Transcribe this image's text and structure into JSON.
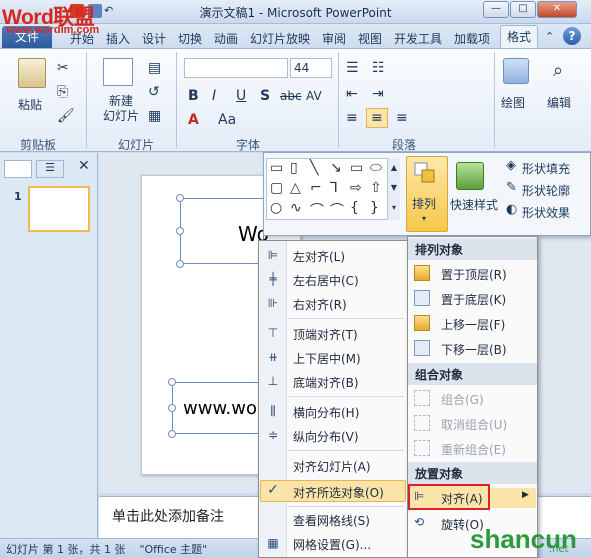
{
  "window": {
    "title": "演示文稿1 - Microsoft PowerPoint",
    "buttons": [
      "—",
      "□",
      "✕"
    ]
  },
  "watermark": {
    "logo": "Word联盟",
    "url": "www.wordlm.com",
    "site": "shancun",
    "site_sub": ".net"
  },
  "tabs": {
    "file": "文件",
    "items": [
      "开始",
      "插入",
      "设计",
      "切换",
      "动画",
      "幻灯片放映",
      "审阅",
      "视图",
      "开发工具",
      "加载项"
    ],
    "format": "格式",
    "help": "?"
  },
  "ribbon": {
    "clipboard": {
      "label": "剪贴板",
      "paste": "粘贴"
    },
    "slides": {
      "label": "幻灯片",
      "new_slide": "新建\n幻灯片"
    },
    "font": {
      "label": "字体",
      "font_name": "",
      "font_size": "44",
      "bold": "B",
      "italic": "I",
      "underline": "U",
      "shadow": "S",
      "strike": "abc",
      "spacing": "AV",
      "color": "A",
      "case": "Aa"
    },
    "paragraph": {
      "label": "段落"
    },
    "drawing": {
      "label": "绘图"
    },
    "edit": {
      "label": "编辑"
    },
    "shape_fill": "形状填充",
    "shape_outline": "形状轮廓",
    "shape_effects": "形状效果",
    "quick_styles": "快速样式",
    "arrange": "排列"
  },
  "slide_panel": {
    "slide_number": "1"
  },
  "slide": {
    "title_text": "Wo",
    "subtitle_text": "www.wo"
  },
  "notes": {
    "placeholder": "单击此处添加备注"
  },
  "status": {
    "text": "幻灯片 第 1 张，共 1 张    \"Office 主题\""
  },
  "align_menu": {
    "items": [
      {
        "label": "左对齐(L)",
        "group": 1
      },
      {
        "label": "左右居中(C)",
        "group": 1
      },
      {
        "label": "右对齐(R)",
        "group": 1
      },
      {
        "label": "顶端对齐(T)",
        "group": 2
      },
      {
        "label": "上下居中(M)",
        "group": 2
      },
      {
        "label": "底端对齐(B)",
        "group": 2
      },
      {
        "label": "横向分布(H)",
        "group": 3
      },
      {
        "label": "纵向分布(V)",
        "group": 3
      },
      {
        "label": "对齐幻灯片(A)",
        "group": 4
      },
      {
        "label": "对齐所选对象(O)",
        "group": 4,
        "checked": true
      },
      {
        "label": "查看网格线(S)",
        "group": 5
      },
      {
        "label": "网格设置(G)...",
        "group": 5
      }
    ]
  },
  "arrange_menu": {
    "sections": [
      {
        "header": "排列对象",
        "items": [
          {
            "label": "置于顶层(R)"
          },
          {
            "label": "置于底层(K)"
          },
          {
            "label": "上移一层(F)"
          },
          {
            "label": "下移一层(B)"
          }
        ]
      },
      {
        "header": "组合对象",
        "items": [
          {
            "label": "组合(G)",
            "disabled": true
          },
          {
            "label": "取消组合(U)",
            "disabled": true
          },
          {
            "label": "重新组合(E)",
            "disabled": true
          }
        ]
      },
      {
        "header": "放置对象",
        "items": [
          {
            "label": "对齐(A)",
            "highlight": true
          },
          {
            "label": "旋转(O)"
          }
        ]
      }
    ]
  },
  "colors": {
    "accent": "#2c5a9b",
    "highlight": "#fbe4a9",
    "red_box": "#d8232a"
  }
}
